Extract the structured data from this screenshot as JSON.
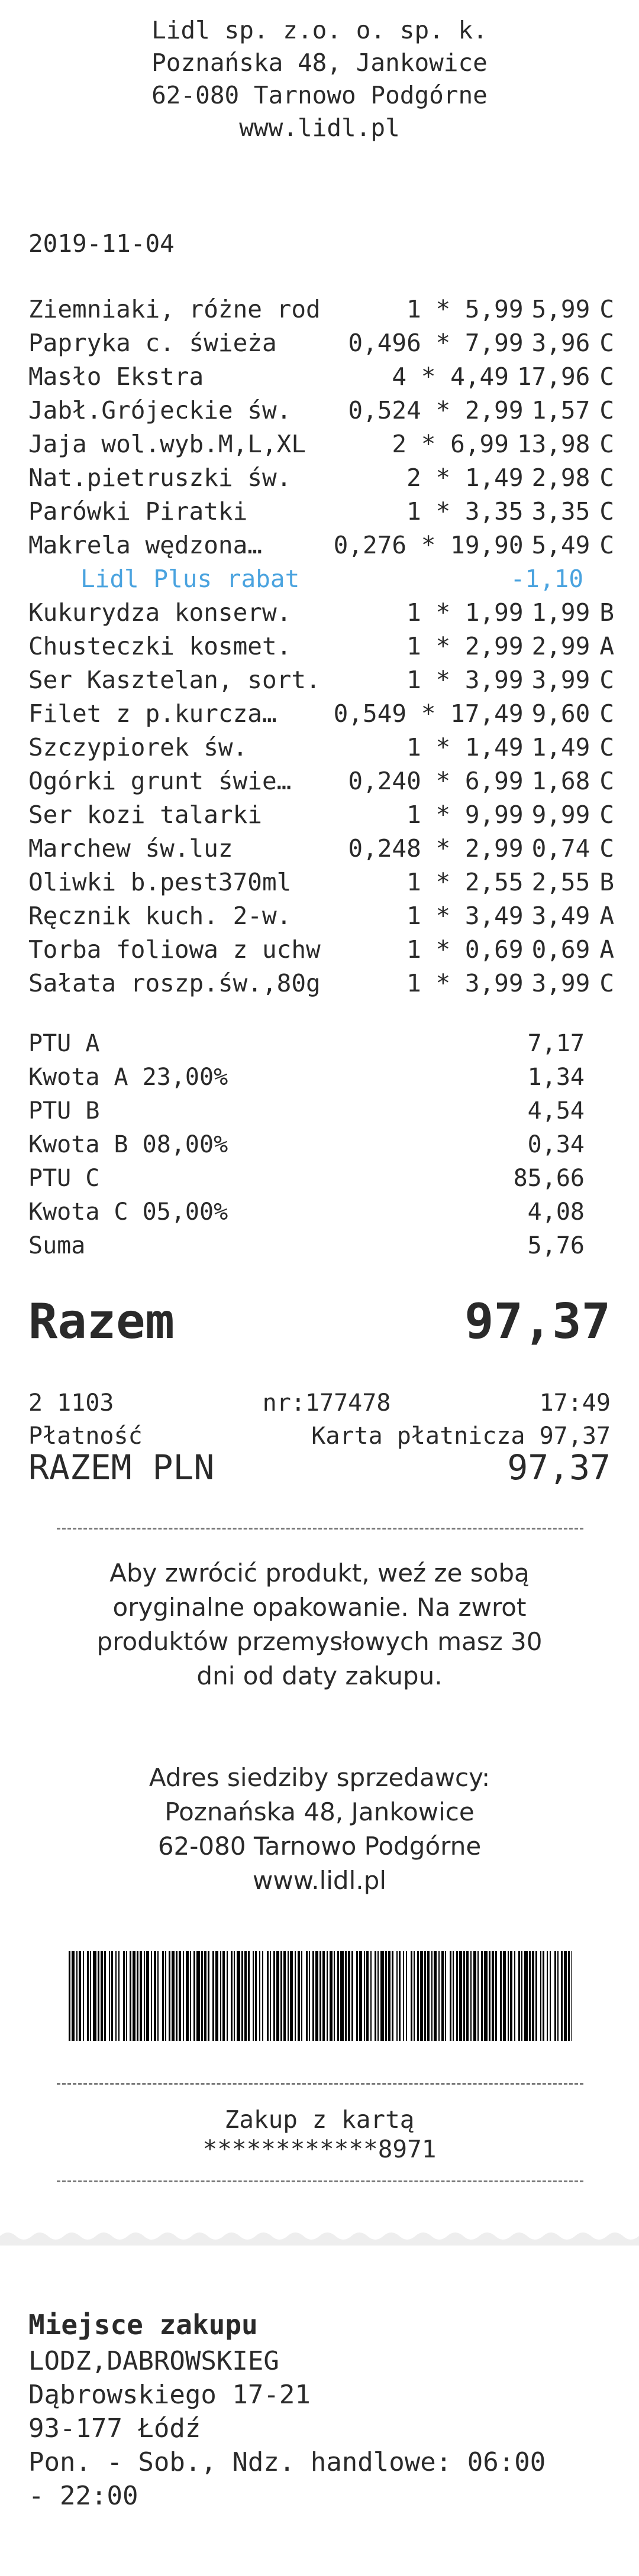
{
  "header": {
    "company": "Lidl sp. z.o. o. sp. k.",
    "street": "Poznańska 48, Jankowice",
    "city": "62-080 Tarnowo Podgórne",
    "website": "www.lidl.pl"
  },
  "date": "2019-11-04",
  "items": [
    {
      "name": "Ziemniaki, różne rod",
      "qty": "1 * 5,99",
      "price": "5,99",
      "tax": "C"
    },
    {
      "name": "Papryka c. świeża",
      "qty": "0,496 * 7,99",
      "price": "3,96",
      "tax": "C"
    },
    {
      "name": "Masło Ekstra",
      "qty": "4 * 4,49",
      "price": "17,96",
      "tax": "C"
    },
    {
      "name": "Jabł.Grójeckie św.",
      "qty": "0,524 * 2,99",
      "price": "1,57",
      "tax": "C"
    },
    {
      "name": "Jaja wol.wyb.M,L,XL",
      "qty": "2 * 6,99",
      "price": "13,98",
      "tax": "C"
    },
    {
      "name": "Nat.pietruszki św.",
      "qty": "2 * 1,49",
      "price": "2,98",
      "tax": "C"
    },
    {
      "name": "Parówki Piratki",
      "qty": "1 * 3,35",
      "price": "3,35",
      "tax": "C"
    },
    {
      "name": "Makrela wędzona…",
      "qty": "0,276 * 19,90",
      "price": "5,49",
      "tax": "C"
    },
    {
      "name": "Kukurydza konserw.",
      "qty": "1 * 1,99",
      "price": "1,99",
      "tax": "B"
    },
    {
      "name": "Chusteczki kosmet.",
      "qty": "1 * 2,99",
      "price": "2,99",
      "tax": "A"
    },
    {
      "name": "Ser Kasztelan, sort.",
      "qty": "1 * 3,99",
      "price": "3,99",
      "tax": "C"
    },
    {
      "name": "Filet z p.kurcza…",
      "qty": "0,549 * 17,49",
      "price": "9,60",
      "tax": "C"
    },
    {
      "name": "Szczypiorek św.",
      "qty": "1 * 1,49",
      "price": "1,49",
      "tax": "C"
    },
    {
      "name": "Ogórki grunt świe…",
      "qty": "0,240 * 6,99",
      "price": "1,68",
      "tax": "C"
    },
    {
      "name": "Ser kozi talarki",
      "qty": "1 * 9,99",
      "price": "9,99",
      "tax": "C"
    },
    {
      "name": "Marchew św.luz",
      "qty": "0,248 * 2,99",
      "price": "0,74",
      "tax": "C"
    },
    {
      "name": "Oliwki b.pest370ml",
      "qty": "1 * 2,55",
      "price": "2,55",
      "tax": "B"
    },
    {
      "name": "Ręcznik kuch. 2-w.",
      "qty": "1 * 3,49",
      "price": "3,49",
      "tax": "A"
    },
    {
      "name": "Torba foliowa z uchw",
      "qty": "1 * 0,69",
      "price": "0,69",
      "tax": "A"
    },
    {
      "name": "Sałata roszp.św.,80g",
      "qty": "1 * 3,99",
      "price": "3,99",
      "tax": "C"
    }
  ],
  "discount": {
    "label": "Lidl Plus rabat",
    "value": "-1,10"
  },
  "vat": [
    {
      "label": "PTU A",
      "value": "7,17"
    },
    {
      "label": "Kwota A 23,00%",
      "value": "1,34"
    },
    {
      "label": "PTU B",
      "value": "4,54"
    },
    {
      "label": "Kwota B 08,00%",
      "value": "0,34"
    },
    {
      "label": "PTU C",
      "value": "85,66"
    },
    {
      "label": "Kwota C 05,00%",
      "value": "4,08"
    },
    {
      "label": "Suma",
      "value": "5,76"
    }
  ],
  "total": {
    "label": "Razem",
    "value": "97,37"
  },
  "transaction": {
    "register": "2 1103",
    "number": "nr:177478",
    "time": "17:49"
  },
  "payment": {
    "label": "Płatność",
    "method": "Karta płatnicza 97,37"
  },
  "razem_pln": {
    "label": "RAZEM PLN",
    "value": "97,37"
  },
  "return_info": [
    "Aby zwrócić produkt, weź ze sobą",
    "oryginalne opakowanie. Na zwrot",
    "produktów przemysłowych masz 30",
    "dni od daty zakupu."
  ],
  "seller_info": {
    "title": "Adres siedziby sprzedawcy:",
    "street": "Poznańska 48, Jankowice",
    "city": "62-080 Tarnowo Podgórne",
    "website": "www.lidl.pl"
  },
  "card": {
    "label": "Zakup z kartą",
    "number": "************8971"
  },
  "store": {
    "title": "Miejsce zakupu",
    "name": "LODZ,DABROWSKIEG",
    "street": "Dąbrowskiego 17-21",
    "city": "93-177 Łódź",
    "hours": [
      "Pon. - Sob., Ndz. handlowe: 06:00",
      "- 22:00"
    ]
  },
  "colors": {
    "text": "#2a2a2a",
    "discount": "#4aa3df",
    "dash": "#7a7a7a"
  }
}
